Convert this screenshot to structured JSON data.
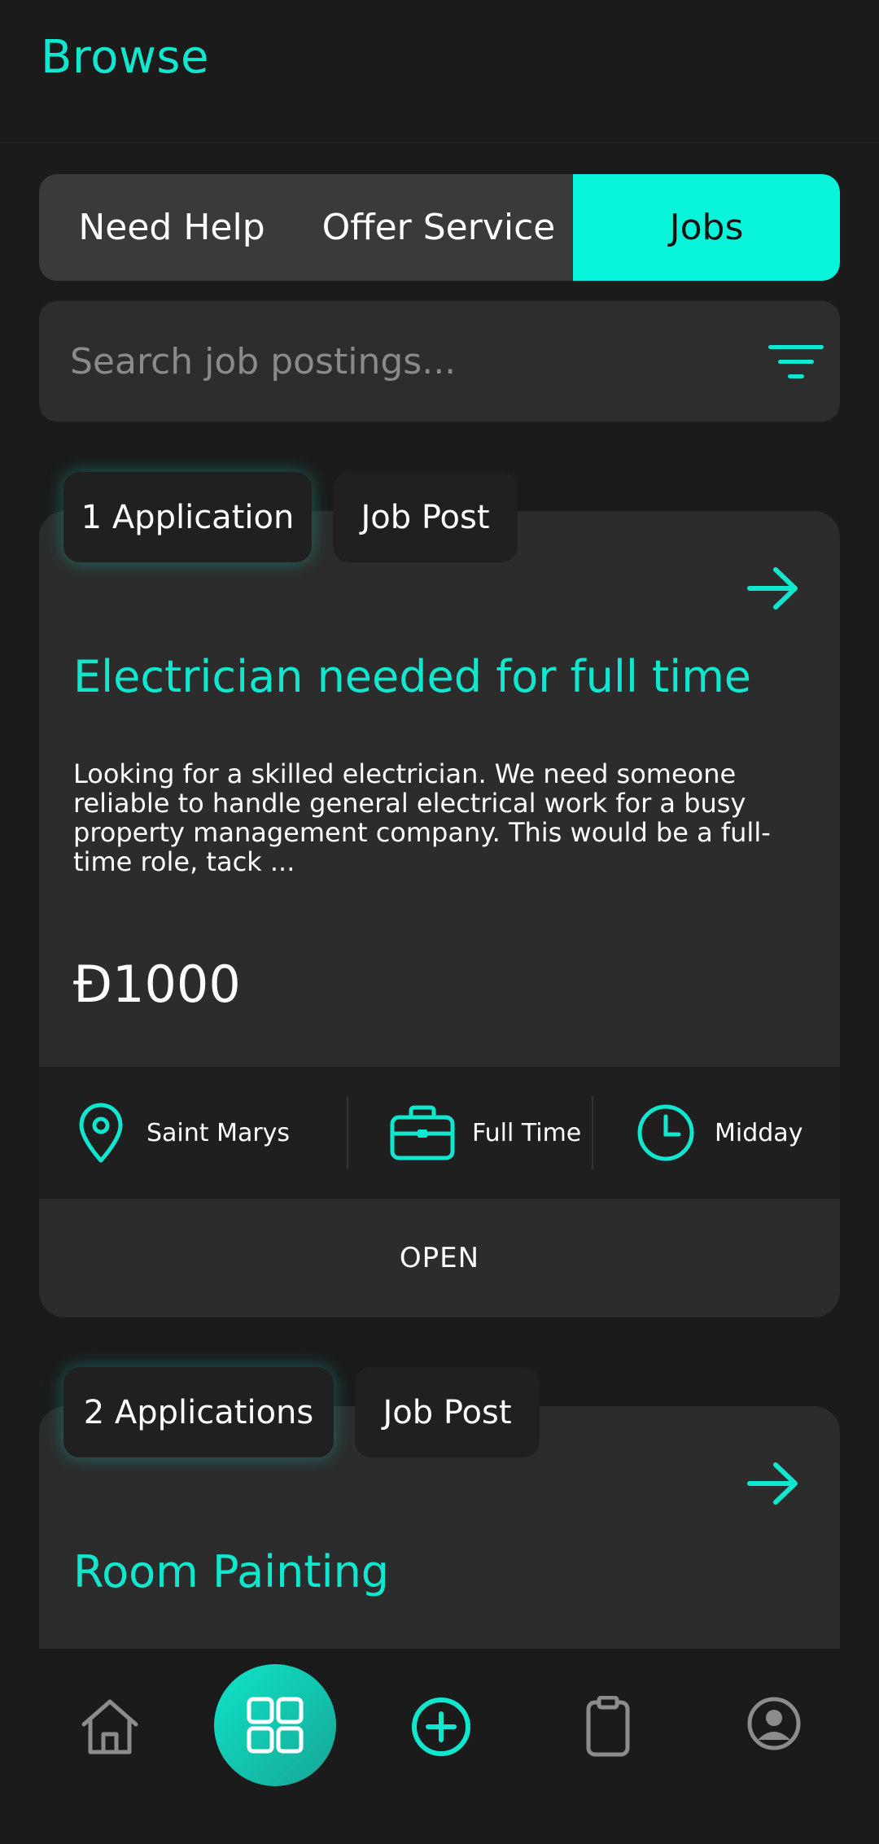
{
  "header": {
    "title": "Browse"
  },
  "segments": {
    "need_help": "Need Help",
    "offer_service": "Offer Service",
    "jobs": "Jobs",
    "active": "Jobs"
  },
  "search": {
    "placeholder": "Search job postings...",
    "value": ""
  },
  "jobs": [
    {
      "applications": "1 Application",
      "tag": "Job Post",
      "title": "Electrician needed for full time",
      "description": "Looking for a skilled electrician. We need someone reliable to handle general electrical work for a busy property management company. This would be a full-time role, tack ...",
      "price": "Đ1000",
      "location": "Saint Marys",
      "type": "Full Time",
      "time": "Midday",
      "status": "OPEN"
    },
    {
      "applications": "2 Applications",
      "tag": "Job Post",
      "title": "Room Painting"
    }
  ],
  "nav": {
    "items": [
      "home-icon",
      "browse-icon",
      "add-icon",
      "clipboard-icon",
      "profile-icon"
    ],
    "active": "browse-icon"
  },
  "colors": {
    "accent": "#08f5dc",
    "background": "#1b1b1b",
    "card": "#2c2c2c"
  }
}
